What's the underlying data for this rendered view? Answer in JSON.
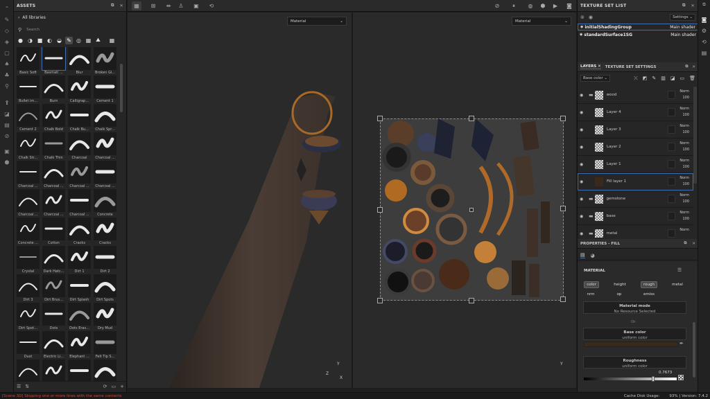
{
  "assets": {
    "title": "ASSETS",
    "breadcrumb": "All libraries",
    "search_placeholder": "Search",
    "items": [
      "Basic Soft",
      "Basmati ...",
      "Blur",
      "Broken Gl...",
      "Bullet im...",
      "Burn",
      "Calligrap...",
      "Cement 1",
      "Cement 2",
      "Chalk Bold",
      "Chalk Bu...",
      "Chalk Spr...",
      "Chalk Str...",
      "Chalk Thin",
      "Charcoal",
      "Charcoal ...",
      "Charcoal ...",
      "Charcoal ...",
      "Charcoal ...",
      "Charcoal ...",
      "Charcoal ...",
      "Charcoal ...",
      "Charcoal ...",
      "Concrete",
      "Concrete ...",
      "Cotton",
      "Cracks",
      "Cracks",
      "Crystal",
      "Dark Hatc...",
      "Dirt 1",
      "Dirt 2",
      "Dirt 3",
      "Dirt Brus...",
      "Dirt Splash",
      "Dirt Spots",
      "Dirt Spot...",
      "Dots",
      "Dots Eras...",
      "Dry Mud",
      "Dust",
      "Electric Li...",
      "Elephant ...",
      "Felt Tip S...",
      "",
      "",
      "",
      ""
    ]
  },
  "viewport": {
    "left_mode": "Material",
    "right_mode": "Material",
    "axis_y": "Y",
    "axis_z": "Z",
    "axis_x": "X"
  },
  "texture_set_list": {
    "title": "TEXTURE SET LIST",
    "settings_label": "Settings",
    "items": [
      {
        "name": "initialShadingGroup",
        "shader": "Main shader"
      },
      {
        "name": "standardSurface1SG",
        "shader": "Main shader"
      }
    ]
  },
  "layers": {
    "tab_layers": "LAYERS",
    "tab_settings": "TEXTURE SET SETTINGS",
    "channel": "Base color",
    "items": [
      {
        "name": "wood",
        "blend": "Norm",
        "opacity": "100",
        "folder": true
      },
      {
        "name": "Layer 4",
        "blend": "Norm",
        "opacity": "100",
        "folder": false
      },
      {
        "name": "Layer 3",
        "blend": "Norm",
        "opacity": "100",
        "folder": false
      },
      {
        "name": "Layer 2",
        "blend": "Norm",
        "opacity": "100",
        "folder": false
      },
      {
        "name": "Layer 1",
        "blend": "Norm",
        "opacity": "100",
        "folder": false
      },
      {
        "name": "Fill layer 1",
        "blend": "Norm",
        "opacity": "100",
        "folder": false
      },
      {
        "name": "gemstone",
        "blend": "Norm",
        "opacity": "100",
        "folder": true
      },
      {
        "name": "base",
        "blend": "Norm",
        "opacity": "100",
        "folder": true
      },
      {
        "name": "metal",
        "blend": "Norm",
        "opacity": "",
        "folder": true
      }
    ]
  },
  "properties": {
    "title": "PROPERTIES - FILL",
    "section": "MATERIAL",
    "channels": [
      "color",
      "height",
      "rough",
      "metal",
      "nrm",
      "op",
      "emiss"
    ],
    "material_mode_label": "Material mode",
    "material_mode_value": "No Resource Selected",
    "or_label": "Or",
    "base_color_label": "Base color",
    "base_color_sub": "uniform color",
    "base_color_hex": "#3a2a1c",
    "roughness_label": "Roughness",
    "roughness_sub": "uniform color",
    "roughness_value": "0.7673"
  },
  "status": {
    "message": "[Scene 3D] Skipping one or more lines with the same contents",
    "cache": "Cache Disk Usage:",
    "cache_value": "93%",
    "version": "| Version: 7.4.2"
  }
}
